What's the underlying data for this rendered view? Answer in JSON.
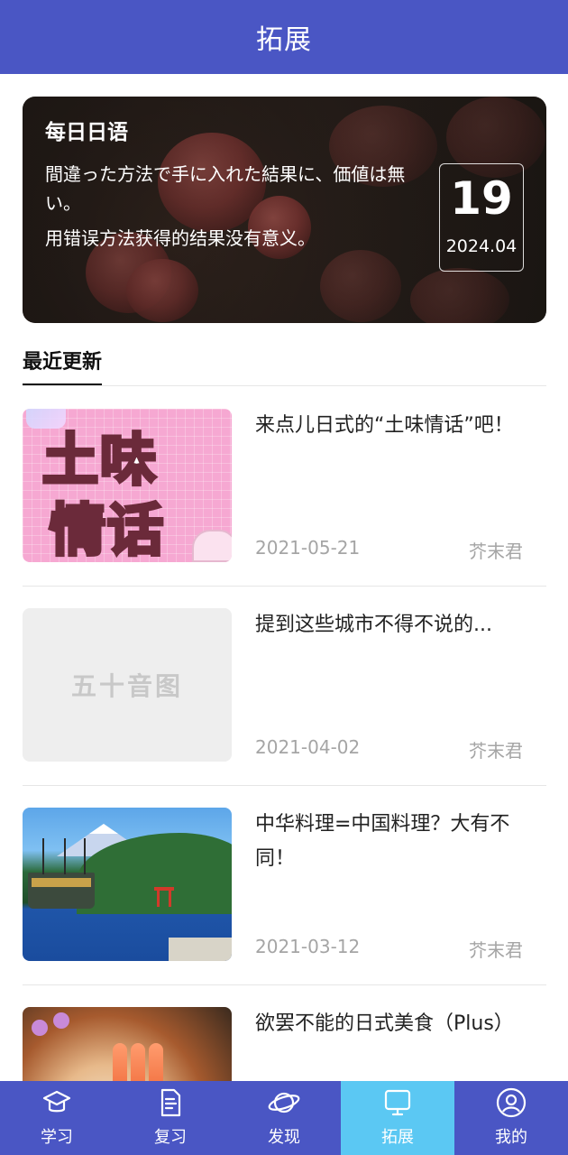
{
  "header": {
    "title": "拓展"
  },
  "daily": {
    "title": "每日日语",
    "japanese": "間違った方法で手に入れた結果に、価値は無い。",
    "chinese": "用错误方法获得的结果没有意义。",
    "day": "19",
    "year_month": "2024.04"
  },
  "section": {
    "tab_label": "最近更新"
  },
  "articles": [
    {
      "title": "来点儿日式的“土味情话”吧！",
      "date": "2021-05-21",
      "author": "芥末君",
      "thumb_text_1": "土味",
      "thumb_text_2": "情话"
    },
    {
      "title": "提到这些城市不得不说的...",
      "date": "2021-04-02",
      "author": "芥末君",
      "thumb_text": "五十音图"
    },
    {
      "title": "中华料理=中国料理？大有不同！",
      "date": "2021-03-12",
      "author": "芥末君"
    },
    {
      "title": "欲罢不能的日式美食（Plus）",
      "date": "",
      "author": ""
    }
  ],
  "bottom_nav": [
    {
      "label": "学习",
      "icon": "graduation-cap-icon"
    },
    {
      "label": "复习",
      "icon": "document-icon"
    },
    {
      "label": "发现",
      "icon": "planet-icon"
    },
    {
      "label": "拓展",
      "icon": "monitor-icon",
      "active": true
    },
    {
      "label": "我的",
      "icon": "user-circle-icon"
    }
  ],
  "colors": {
    "primary": "#4a56c4",
    "active_tab": "#5bc8f3",
    "meta_text": "#a5a5a5"
  }
}
